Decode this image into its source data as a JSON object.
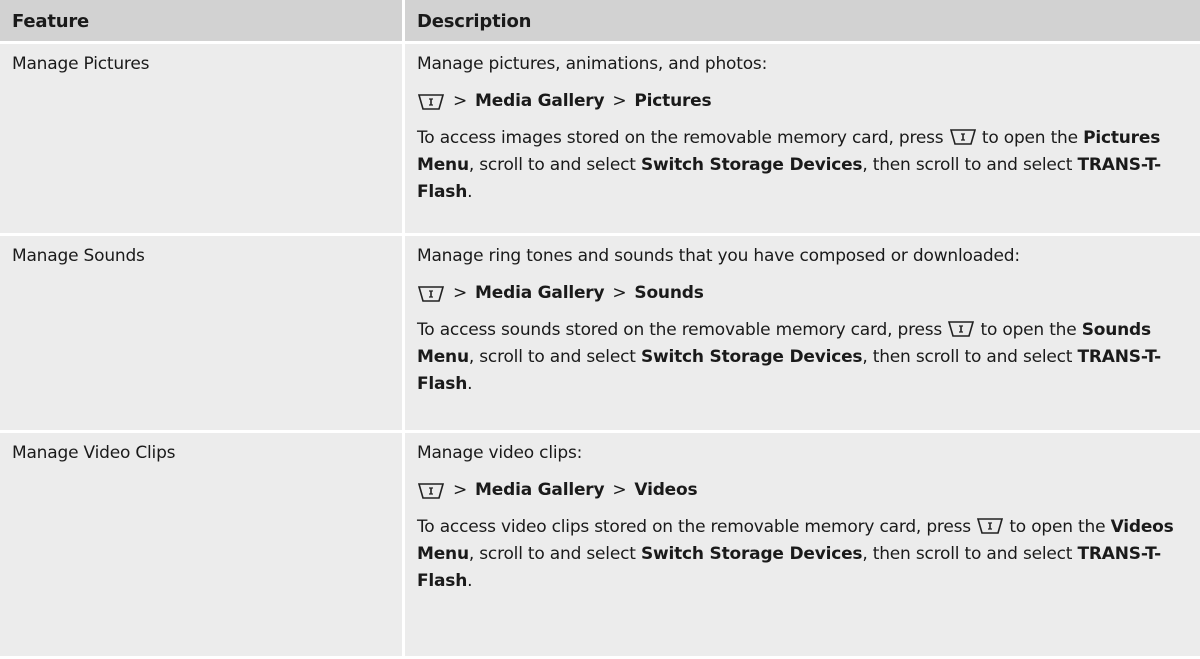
{
  "header": {
    "feature": "Feature",
    "description": "Description"
  },
  "icons": {
    "menu_key": "menu-key-icon"
  },
  "rows": [
    {
      "feature": "Manage Pictures",
      "intro": "Manage pictures, animations, and photos:",
      "path": {
        "gt1": ">",
        "item1": "Media Gallery",
        "gt2": ">",
        "item2": "Pictures"
      },
      "access": {
        "t1": "To access images stored on the removable memory card, press",
        "t2": "to open the",
        "menu": "Pictures Menu",
        "t3": ", scroll to and select",
        "storage": "Switch Storage Devices",
        "t4": ", then scroll to and select",
        "card": "TRANS-T-Flash",
        "t5": "."
      }
    },
    {
      "feature": "Manage Sounds",
      "intro": "Manage ring tones and sounds that you have composed or downloaded:",
      "path": {
        "gt1": ">",
        "item1": "Media Gallery",
        "gt2": ">",
        "item2": "Sounds"
      },
      "access": {
        "t1": "To access sounds stored on the removable memory card, press",
        "t2": "to open the",
        "menu": "Sounds Menu",
        "t3": ", scroll to and select",
        "storage": "Switch Storage Devices",
        "t4": ", then scroll to and select",
        "card": "TRANS-T-Flash",
        "t5": "."
      }
    },
    {
      "feature": "Manage Video Clips",
      "intro": "Manage video clips:",
      "path": {
        "gt1": ">",
        "item1": "Media Gallery",
        "gt2": ">",
        "item2": "Videos"
      },
      "access": {
        "t1": "To access video clips stored on the removable memory card, press",
        "t2": "to open the",
        "menu": "Videos Menu",
        "t3": ", scroll to and select",
        "storage": "Switch Storage Devices",
        "t4": ", then scroll to and select",
        "card": "TRANS-T-Flash",
        "t5": "."
      }
    }
  ]
}
